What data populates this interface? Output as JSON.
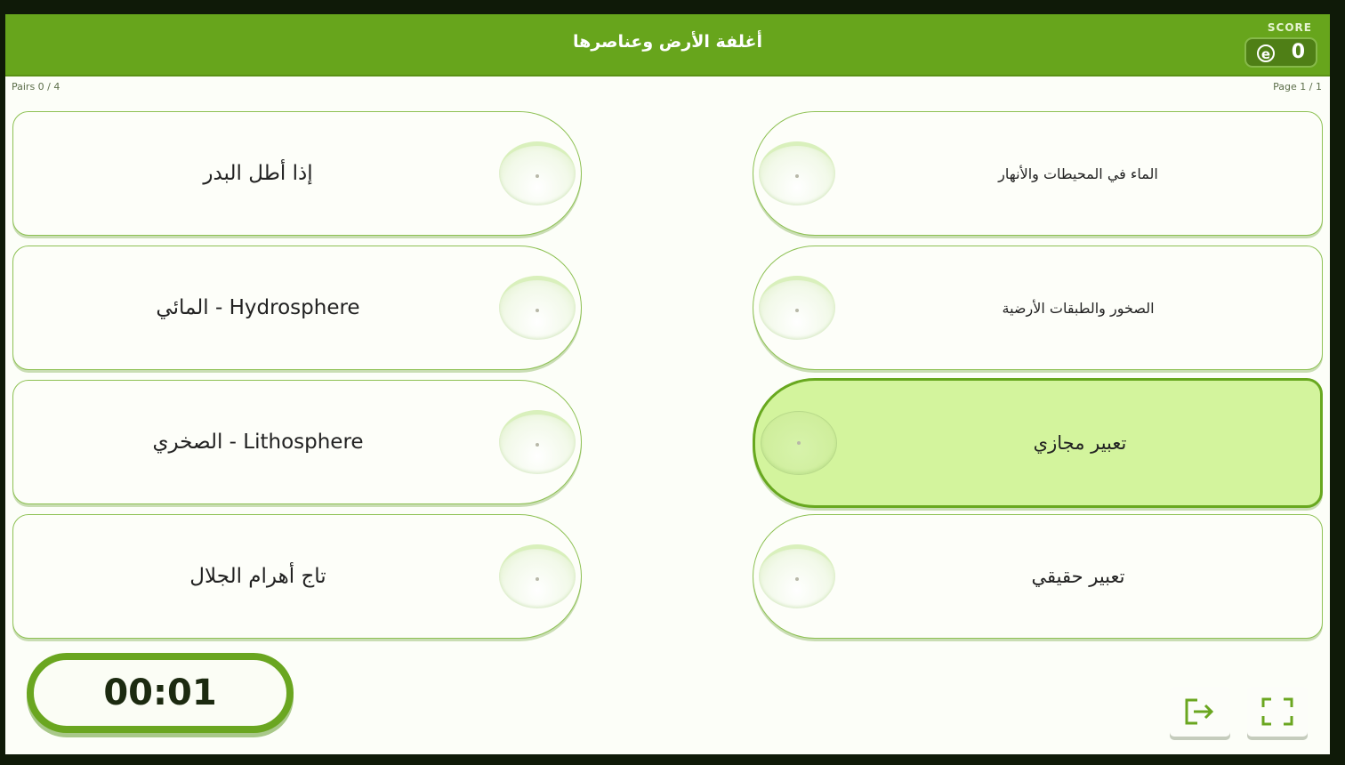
{
  "header": {
    "title": "أغلفة الأرض وعناصرها",
    "score_label": "SCORE",
    "score_icon": "e-coin-icon",
    "score_value": "0"
  },
  "status": {
    "pairs": "Pairs 0 / 4",
    "page": "Page 1 / 1"
  },
  "left_cards": [
    {
      "label": "إذا أطل البدر"
    },
    {
      "label": "Hydrosphere - المائي"
    },
    {
      "label": "Lithosphere - الصخري"
    },
    {
      "label": "تاج أهرام الجلال"
    }
  ],
  "right_cards": [
    {
      "label": "الماء في المحيطات والأنهار",
      "selected": false
    },
    {
      "label": "الصخور والطبقات الأرضية",
      "selected": false
    },
    {
      "label": "تعبير مجازي",
      "selected": true
    },
    {
      "label": "تعبير حقيقي",
      "selected": false
    }
  ],
  "timer": {
    "value": "00:01"
  },
  "controls": {
    "exit_icon": "exit-icon",
    "fullscreen_icon": "fullscreen-icon"
  },
  "colors": {
    "header": "#67a51c",
    "selected_card": "#d3f49d",
    "card_border": "#8ec154"
  }
}
